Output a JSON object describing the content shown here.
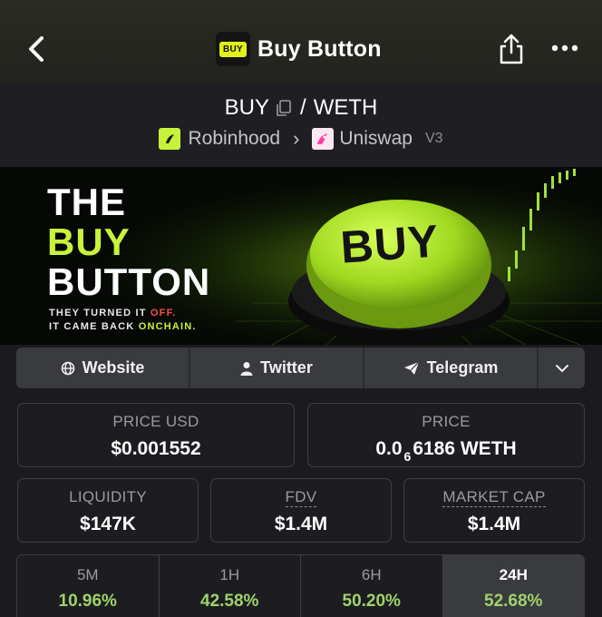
{
  "header": {
    "title": "Buy Button",
    "logo_text": "BUY"
  },
  "pair": {
    "base": "BUY",
    "quote": "WETH",
    "separator": "/",
    "chain": "Robinhood",
    "dex": "Uniswap",
    "version": "V3"
  },
  "banner": {
    "line1": "THE",
    "line2": "BUY",
    "line3": "BUTTON",
    "sub1_a": "THEY TURNED IT ",
    "sub1_b": "OFF.",
    "sub2_a": "IT CAME BACK ",
    "sub2_b": "ONCHAIN.",
    "button_text": "BUY"
  },
  "links": {
    "website": "Website",
    "twitter": "Twitter",
    "telegram": "Telegram"
  },
  "stats": {
    "price_usd_label": "PRICE USD",
    "price_usd": "$0.001552",
    "price_label": "PRICE",
    "price_prefix": "0.0",
    "price_zeros": "6",
    "price_suffix": "6186 WETH",
    "liquidity_label": "LIQUIDITY",
    "liquidity": "$147K",
    "fdv_label": "FDV",
    "fdv": "$1.4M",
    "mcap_label": "MARKET CAP",
    "mcap": "$1.4M"
  },
  "timeframes": [
    {
      "label": "5M",
      "value": "10.96%"
    },
    {
      "label": "1H",
      "value": "42.58%"
    },
    {
      "label": "6H",
      "value": "50.20%"
    },
    {
      "label": "24H",
      "value": "52.68%"
    }
  ],
  "colors": {
    "accent_lime": "#c9f33b",
    "positive": "#9fd36a",
    "logo_yellow": "#e2f01c",
    "red": "#ff4a4a"
  }
}
